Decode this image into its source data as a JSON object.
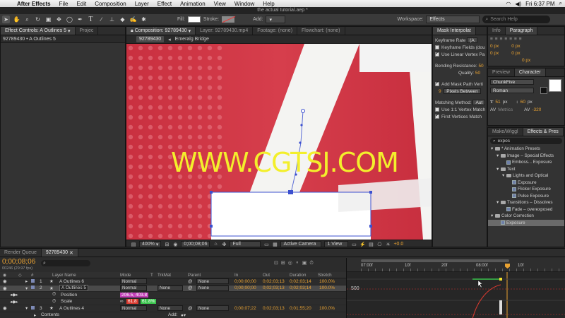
{
  "menubar": {
    "items": [
      "After Effects",
      "File",
      "Edit",
      "Composition",
      "Layer",
      "Effect",
      "Animation",
      "View",
      "Window",
      "Help"
    ],
    "clock": "Fri 6:37 PM",
    "icons": [
      "apple-icon",
      "wifi-icon",
      "volume-icon",
      "spotlight-icon"
    ]
  },
  "document_title": "the actual tutorial.aep *",
  "toolbar": {
    "fill_label": "Fill:",
    "stroke_label": "Stroke:",
    "add_label": "Add:",
    "workspace_label": "Workspace:",
    "workspace_value": "Effects",
    "search_placeholder": "Search Help"
  },
  "left_panel": {
    "tab_effects": "Effect Controls: A Outlines 5",
    "tab_project": "Projec",
    "subtitle": "92789430 • A Outlines 5"
  },
  "comp_panel": {
    "tab_comp": "Composition: 92789430",
    "tab_layer": "Layer: 92789430.mp4",
    "tab_footage": "Footage: (none)",
    "tab_flowchart": "Flowchart: (none)",
    "chip_comp": "92789430",
    "chip_layer": "Emeralg Bridge",
    "watermark": "WWW.CGTSJ.COM",
    "footer": {
      "zoom": "400%",
      "timecode": "0;00;08;06",
      "resolution": "Full",
      "camera": "Active Camera",
      "views": "1 View",
      "exposure": "+0.0"
    }
  },
  "mask_panel": {
    "tab": "Mask Interpolat",
    "keyframe_rate_label": "Keyframe Rate",
    "keyframe_rate_value": "(A",
    "keyframe_fields": "Keyframe Fields (dou",
    "linear_vertex": "Use Linear Vertex Pa",
    "bending_label": "Bending Resistance:",
    "bending_value": "50",
    "quality_label": "Quality:",
    "quality_value": "50",
    "add_mask_path": "Add Mask Path Verti",
    "pixels_value": "9",
    "pixels_between": "Pixels Between",
    "matching_label": "Matching Method:",
    "matching_value": "Aut",
    "use_1to1": "Use 1:1 Vertex Match",
    "first_vertices": "First Vertices Match"
  },
  "info_panel": {
    "tab_info": "Info",
    "tab_paragraph": "Paragraph",
    "vals": [
      "0 px",
      "0 px",
      "0 px",
      "0 px",
      "0 px"
    ]
  },
  "character_panel": {
    "tab_preview": "Preview",
    "tab_character": "Character",
    "font": "ChunkFive",
    "style": "Roman",
    "size": "51",
    "size_unit": "px",
    "leading": "60",
    "leading_unit": "px",
    "kerning": "Metrics",
    "tracking": "-320"
  },
  "effects_panel": {
    "tab_wiggler": "Make/Wiggl",
    "tab_presets": "Effects & Pres",
    "search_value": "expos",
    "tree": [
      {
        "label": "* Animation Presets",
        "indent": 0,
        "kind": "folder"
      },
      {
        "label": "Image – Special Effects",
        "indent": 1,
        "kind": "folder"
      },
      {
        "label": "Emboss... Exposure",
        "indent": 2,
        "kind": "preset"
      },
      {
        "label": "Text",
        "indent": 1,
        "kind": "folder"
      },
      {
        "label": "Lights and Optical",
        "indent": 2,
        "kind": "folder"
      },
      {
        "label": "Exposure",
        "indent": 3,
        "kind": "preset"
      },
      {
        "label": "Flicker Exposure",
        "indent": 3,
        "kind": "preset"
      },
      {
        "label": "Pulse Exposure",
        "indent": 3,
        "kind": "preset"
      },
      {
        "label": "Transitions – Dissolves",
        "indent": 1,
        "kind": "folder"
      },
      {
        "label": "Fade – overexposed",
        "indent": 2,
        "kind": "preset"
      },
      {
        "label": "Color Correction",
        "indent": 0,
        "kind": "folder"
      },
      {
        "label": "Exposure",
        "indent": 1,
        "kind": "preset",
        "selected": true
      }
    ]
  },
  "timeline": {
    "tab_render": "Render Queue",
    "tab_comp": "92789430",
    "timecode": "0;00;08;06",
    "fps": "00246 (29.97 fps)",
    "search_placeholder": "",
    "headers": {
      "name": "Layer Name",
      "mode": "Mode",
      "t": "T",
      "trkmat": "TrkMat",
      "parent": "Parent",
      "in": "In",
      "out": "Out",
      "duration": "Duration",
      "stretch": "Stretch"
    },
    "layers": [
      {
        "num": "1",
        "name": "A Outlines 6",
        "mode": "Normal",
        "trkmat": "",
        "parent": "None",
        "in": "0;00;00;00",
        "out": "0;02;03;13",
        "duration": "0;02;03;14",
        "stretch": "100.0%"
      },
      {
        "num": "2",
        "name": "A Outlines 5",
        "mode": "Normal",
        "trkmat": "None",
        "parent": "None",
        "in": "0;00;00;00",
        "out": "0;02;03;13",
        "duration": "0;02;03;14",
        "stretch": "100.0%"
      },
      {
        "num": "3",
        "name": "A Outlines 4",
        "mode": "Normal",
        "trkmat": "None",
        "parent": "None",
        "in": "0;00;07;22",
        "out": "0;02;03;13",
        "duration": "0;01;55;20",
        "stretch": "100.0%"
      }
    ],
    "props": [
      {
        "name": "Position",
        "value": "206.5, 403.8"
      },
      {
        "name": "Scale",
        "value_a": "61.8",
        "value_b": "61.8%"
      }
    ],
    "contents_label": "Contents",
    "add_label": "Add:",
    "ruler": [
      "07:00f",
      "10f",
      "20f",
      "08:00f",
      "10f"
    ],
    "graph_value": "500"
  }
}
